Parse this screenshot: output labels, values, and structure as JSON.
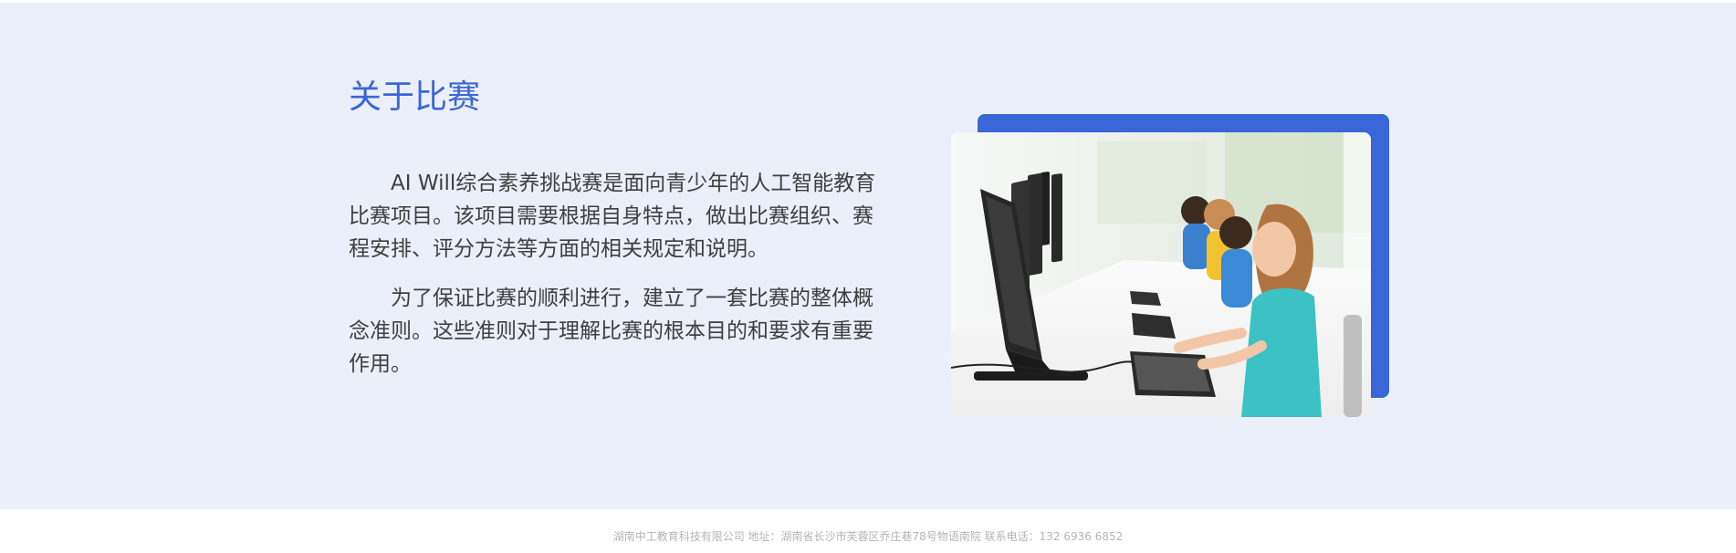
{
  "about": {
    "title": "关于比赛",
    "paragraphs": [
      "AI Will综合素养挑战赛是面向青少年的人工智能教育比赛项目。该项目需要根据自身特点，做出比赛组织、赛程安排、评分方法等方面的相关规定和说明。",
      "为了保证比赛的顺利进行，建立了一套比赛的整体概念准则。这些准则对于理解比赛的根本目的和要求有重要作用。"
    ]
  },
  "photo": {
    "accent_color": "#3a66d8"
  },
  "colors": {
    "section_background": "#ebeff9",
    "title": "#3a66d8",
    "body_text": "#3f3f3f",
    "footer_text": "#b4b4b4"
  },
  "footer": {
    "text": "湖南中工教育科技有限公司 地址：湖南省长沙市芙蓉区乔庄巷78号物语南院 联系电话：132 6936 6852"
  }
}
